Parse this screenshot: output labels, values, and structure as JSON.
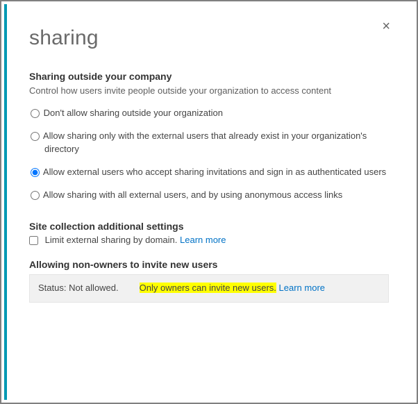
{
  "title": "sharing",
  "close_label": "×",
  "section_sharing": {
    "heading": "Sharing outside your company",
    "desc": "Control how users invite people outside your organization to access content",
    "options": [
      "Don't allow sharing outside your organization",
      "Allow sharing only with the external users that already exist in your organization's directory",
      "Allow external users who accept sharing invitations and sign in as authenticated users",
      "Allow sharing with all external users, and by using anonymous access links"
    ],
    "selected_index": 2
  },
  "section_additional": {
    "heading": "Site collection additional settings",
    "limit_label": "Limit external sharing by domain.",
    "learn_more": "Learn more"
  },
  "section_nonowners": {
    "heading": "Allowing non-owners to invite new users",
    "status_label": "Status:",
    "status_value": "Not allowed.",
    "owners_text": "Only owners can invite new users.",
    "learn_more": "Learn more"
  }
}
